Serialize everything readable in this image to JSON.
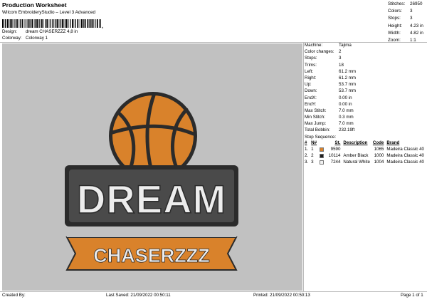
{
  "header": {
    "title": "Production Worksheet",
    "subtitle": "Wilcom EmbroideryStudio – Level 3 Advanced",
    "barcode_mark": ","
  },
  "info": {
    "design_label": "Design:",
    "design_value": "dream CHASERZZZ  4,8 in",
    "colorway_label": "Colorway:",
    "colorway_value": "Colorway 1"
  },
  "stats": [
    {
      "label": "Stitches:",
      "value": "26950"
    },
    {
      "label": "Colors:",
      "value": "3"
    },
    {
      "label": "Stops:",
      "value": "3"
    },
    {
      "label": "Height:",
      "value": "4.23 in"
    },
    {
      "label": "Width:",
      "value": "4.82 in"
    },
    {
      "label": "Zoom:",
      "value": "1:1"
    }
  ],
  "details": [
    {
      "label": "Machine:",
      "value": "Tajima"
    },
    {
      "label": "Color changes:",
      "value": "2"
    },
    {
      "label": "Stops:",
      "value": "3"
    },
    {
      "label": "Trims:",
      "value": "18"
    },
    {
      "label": "Left:",
      "value": "61.2 mm"
    },
    {
      "label": "Right:",
      "value": "61.2 mm"
    },
    {
      "label": "Up:",
      "value": "53.7 mm"
    },
    {
      "label": "Down:",
      "value": "53.7 mm"
    },
    {
      "label": "EndX:",
      "value": "0.00 in"
    },
    {
      "label": "EndY:",
      "value": "0.00 in"
    },
    {
      "label": "Max Stitch:",
      "value": "7.0 mm"
    },
    {
      "label": "Min Stitch:",
      "value": "0.3 mm"
    },
    {
      "label": "Max Jump:",
      "value": "7.0 mm"
    },
    {
      "label": "Total Bobbin:",
      "value": "232.19ft"
    }
  ],
  "stop_sequence": {
    "title": "Stop Sequence:",
    "headers": [
      "#",
      "N#",
      "",
      "St.",
      "Description",
      "Code",
      "Brand"
    ],
    "rows": [
      {
        "num": "1.",
        "n": "1",
        "color": "#d9822b",
        "stitches": "9590",
        "description": "",
        "code": "1065",
        "brand": "Madeira Classic 40"
      },
      {
        "num": "2.",
        "n": "2",
        "color": "#1e1e1e",
        "stitches": "10114",
        "description": "Amber Black",
        "code": "1000",
        "brand": "Madeira Classic 40"
      },
      {
        "num": "3.",
        "n": "3",
        "color": "#f2f2f2",
        "stitches": "7244",
        "description": "Natural White",
        "code": "1004",
        "brand": "Madeira Classic 40"
      }
    ]
  },
  "design": {
    "main_text": "DREAM",
    "sub_text": "CHASERZZZ",
    "colors": {
      "orange": "#d9822b",
      "black": "#2b2b2b",
      "white": "#ededed",
      "background": "#c1c1c1"
    }
  },
  "footer": {
    "created_by": "Created By:",
    "last_saved": "Last Saved: 21/09/2022 00:50:11",
    "printed": "Printed: 21/09/2022 00:50:13",
    "page": "Page 1 of 1"
  }
}
